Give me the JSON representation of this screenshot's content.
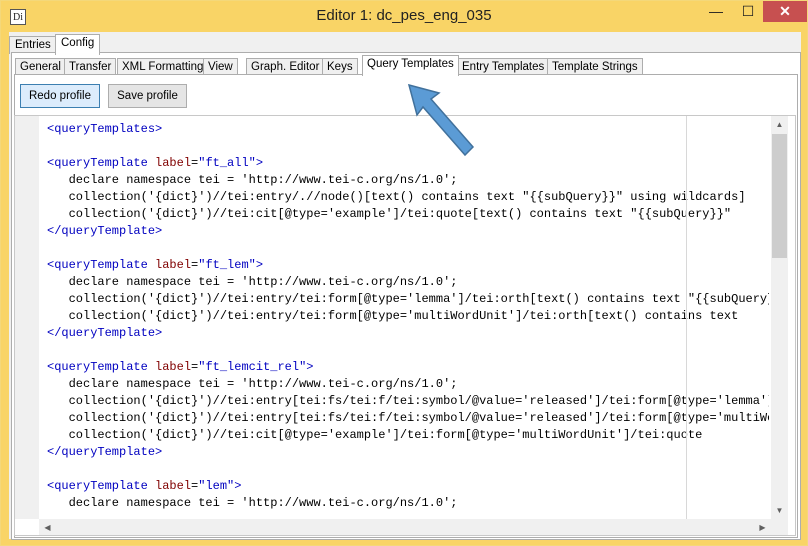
{
  "window": {
    "icon_text": "Di",
    "title": "Editor 1: dc_pes_eng_035",
    "min_label": "—",
    "max_label": "☐",
    "close_label": "✕"
  },
  "outer_tabs": [
    "Entries",
    "Config"
  ],
  "inner_tabs": [
    "General",
    "Transfer",
    "XML Formatting",
    "View",
    "Graph. Editor",
    "Keys",
    "Query Templates",
    "Entry Templates",
    "Template Strings"
  ],
  "buttons": {
    "redo": "Redo profile",
    "save": "Save profile"
  },
  "icons": {
    "pointer": "blue-arrow-icon",
    "scroll_up": "triangle-up",
    "scroll_down": "triangle-down",
    "scroll_left": "triangle-left",
    "scroll_right": "triangle-right"
  },
  "colors": {
    "titlebar": "#f9d466",
    "tag": "#0000c0",
    "attribute": "#800000",
    "arrow": "#5b9bd5"
  },
  "code_lines": [
    {
      "text": "<queryTemplates>",
      "kind": "tag"
    },
    {
      "text": "",
      "kind": "plain"
    },
    {
      "text": "<queryTemplate label=\"ft_all\">",
      "kind": "tag-attr"
    },
    {
      "text": "   declare namespace tei = 'http://www.tei-c.org/ns/1.0';",
      "kind": "plain"
    },
    {
      "text": "   collection('{dict}')//tei:entry/.//node()[text() contains text \"{{subQuery}}\" using wildcards]",
      "kind": "plain"
    },
    {
      "text": "   collection('{dict}')//tei:cit[@type='example']/tei:quote[text() contains text \"{{subQuery}}\"",
      "kind": "plain"
    },
    {
      "text": "</queryTemplate>",
      "kind": "tag"
    },
    {
      "text": "",
      "kind": "plain"
    },
    {
      "text": "<queryTemplate label=\"ft_lem\">",
      "kind": "tag-attr"
    },
    {
      "text": "   declare namespace tei = 'http://www.tei-c.org/ns/1.0';",
      "kind": "plain"
    },
    {
      "text": "   collection('{dict}')//tei:entry/tei:form[@type='lemma']/tei:orth[text() contains text \"{{subQuery}}\"",
      "kind": "plain"
    },
    {
      "text": "   collection('{dict}')//tei:entry/tei:form[@type='multiWordUnit']/tei:orth[text() contains text",
      "kind": "plain"
    },
    {
      "text": "</queryTemplate>",
      "kind": "tag"
    },
    {
      "text": "",
      "kind": "plain"
    },
    {
      "text": "<queryTemplate label=\"ft_lemcit_rel\">",
      "kind": "tag-attr"
    },
    {
      "text": "   declare namespace tei = 'http://www.tei-c.org/ns/1.0';",
      "kind": "plain"
    },
    {
      "text": "   collection('{dict}')//tei:entry[tei:fs/tei:f/tei:symbol/@value='released']/tei:form[@type='lemma']",
      "kind": "plain"
    },
    {
      "text": "   collection('{dict}')//tei:entry[tei:fs/tei:f/tei:symbol/@value='released']/tei:form[@type='multiWordUnit']",
      "kind": "plain"
    },
    {
      "text": "   collection('{dict}')//tei:cit[@type='example']/tei:form[@type='multiWordUnit']/tei:quote",
      "kind": "plain"
    },
    {
      "text": "</queryTemplate>",
      "kind": "tag"
    },
    {
      "text": "",
      "kind": "plain"
    },
    {
      "text": "<queryTemplate label=\"lem\">",
      "kind": "tag-attr"
    },
    {
      "text": "   declare namespace tei = 'http://www.tei-c.org/ns/1.0';",
      "kind": "plain"
    }
  ]
}
